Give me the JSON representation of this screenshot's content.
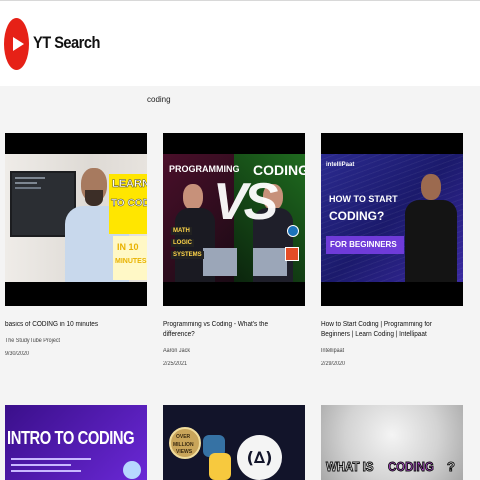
{
  "header": {
    "app_title": "YT Search",
    "logo_icon": "youtube-play-icon",
    "brand_color": "#e62117"
  },
  "search": {
    "value": "coding"
  },
  "videos": [
    {
      "title": "basics of CODING in 10 minutes",
      "channel": "The StudyTube Project",
      "date": "9/30/2020",
      "thumb_text": [
        "LEARN",
        "TO CODE",
        "IN 10",
        "MINUTES"
      ]
    },
    {
      "title": "Programming vs Coding - What's the difference?",
      "channel": "Aaron Jack",
      "date": "2/25/2021",
      "thumb_text": [
        "PROGRAMMING",
        "VS",
        "CODING",
        "MATH",
        "LOGIC",
        "SYSTEMS"
      ]
    },
    {
      "title": "How to Start Coding | Programming for Beginners | Learn Coding | Intellipaat",
      "channel": "Intellipaat",
      "date": "2/29/2020",
      "thumb_text": [
        "intelliPaat",
        "HOW TO START",
        "CODING?",
        "FOR BEGINNERS"
      ]
    },
    {
      "thumb_text": [
        "INTRO TO CODING"
      ]
    },
    {
      "thumb_text": [
        "OVER",
        "MILLION",
        "VIEWS"
      ]
    },
    {
      "thumb_text": [
        "WHAT IS",
        "CODING",
        "?"
      ]
    }
  ]
}
